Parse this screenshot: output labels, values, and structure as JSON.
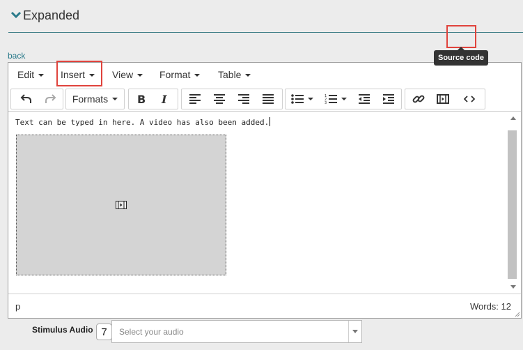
{
  "section": {
    "title": "Expanded"
  },
  "back_link": "back",
  "menubar": {
    "items": [
      {
        "label": "Edit"
      },
      {
        "label": "Insert"
      },
      {
        "label": "View"
      },
      {
        "label": "Format"
      },
      {
        "label": "Table"
      }
    ]
  },
  "toolbar": {
    "formats_label": "Formats",
    "tooltip": "Source code",
    "icons": [
      "undo-icon",
      "redo-icon",
      "bold-icon",
      "italic-icon",
      "align-left-icon",
      "align-center-icon",
      "align-right-icon",
      "align-justify-icon",
      "bullet-list-icon",
      "numbered-list-icon",
      "outdent-icon",
      "indent-icon",
      "link-icon",
      "video-icon",
      "source-code-icon"
    ]
  },
  "content": {
    "text": "Text can be typed in here.  A video has also been added."
  },
  "statusbar": {
    "path": "p",
    "word_count": "Words: 12"
  },
  "stimulus": {
    "label": "Stimulus Audio",
    "number": "7",
    "placeholder": "Select your audio"
  },
  "colors": {
    "highlight": "#e0433c",
    "section_rule": "#3f7f87",
    "link": "#2a7a8a",
    "tooltip_bg": "#333333"
  }
}
